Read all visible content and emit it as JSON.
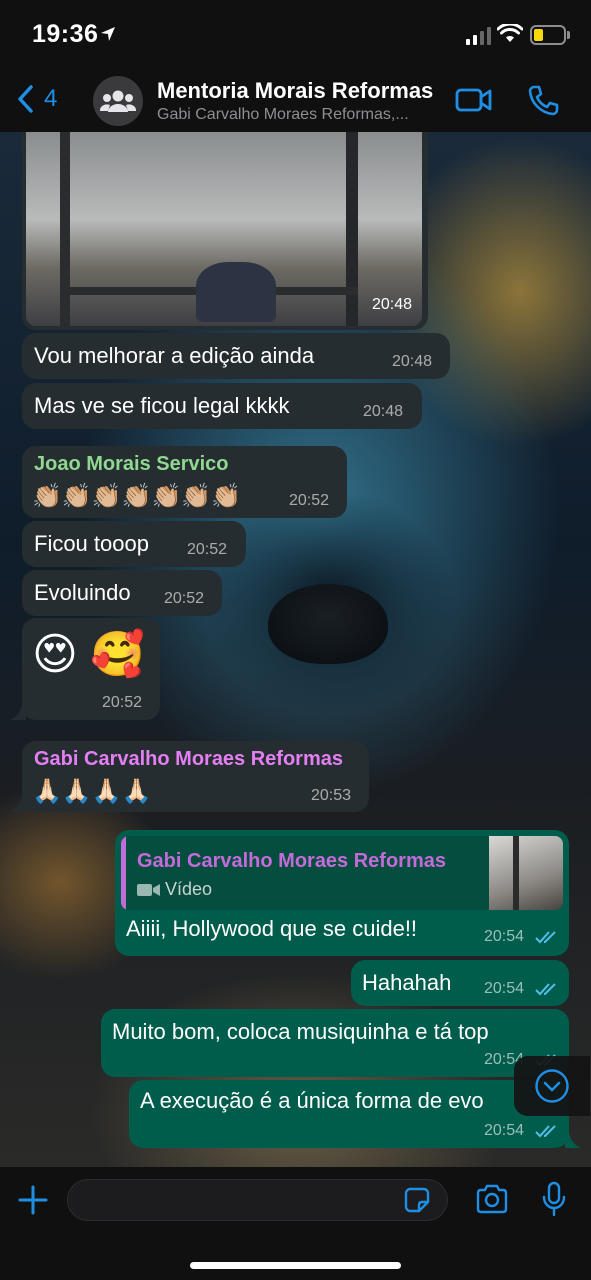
{
  "status_bar": {
    "time": "19:36"
  },
  "header": {
    "back_count": "4",
    "title": "Mentoria Morais Reformas",
    "subtitle": "Gabi Carvalho Moraes Reformas,..."
  },
  "messages": {
    "m0": {
      "time": "20:48"
    },
    "m1": {
      "text": "Vou melhorar a edição ainda",
      "time": "20:48"
    },
    "m2": {
      "text": "Mas ve se ficou legal kkkk",
      "time": "20:48"
    },
    "m3": {
      "sender": "Joao Morais Servico",
      "text": "👏🏼👏🏼👏🏼👏🏼👏🏼👏🏼👏🏼",
      "time": "20:52",
      "sender_color": "#8fd88f"
    },
    "m4": {
      "text": "Ficou tooop",
      "time": "20:52"
    },
    "m5": {
      "text": "Evoluindo",
      "time": "20:52"
    },
    "m6": {
      "text": "😍 🥰",
      "time": "20:52"
    },
    "m7": {
      "sender": "Gabi Carvalho Moraes Reformas",
      "text": "🙏🏻🙏🏻🙏🏻🙏🏻",
      "time": "20:53",
      "sender_color": "#e37ff2"
    },
    "m8": {
      "quote_sender": "Gabi Carvalho Moraes Reformas",
      "quote_text": "Vídeo",
      "text": "Aiiii, Hollywood que se cuide!!",
      "time": "20:54"
    },
    "m9": {
      "text": "Hahahah",
      "time": "20:54"
    },
    "m10": {
      "text": "Muito bom, coloca musiquinha e tá top",
      "time": "20:54"
    },
    "m11": {
      "text": "A execução é a única forma de evo",
      "time": "20:54"
    }
  },
  "input": {
    "placeholder": ""
  },
  "colors": {
    "accent": "#1f8fe5",
    "outgoing_bubble": "#005c4b",
    "incoming_bubble": "#262d31",
    "read_ticks": "#53bdeb"
  }
}
